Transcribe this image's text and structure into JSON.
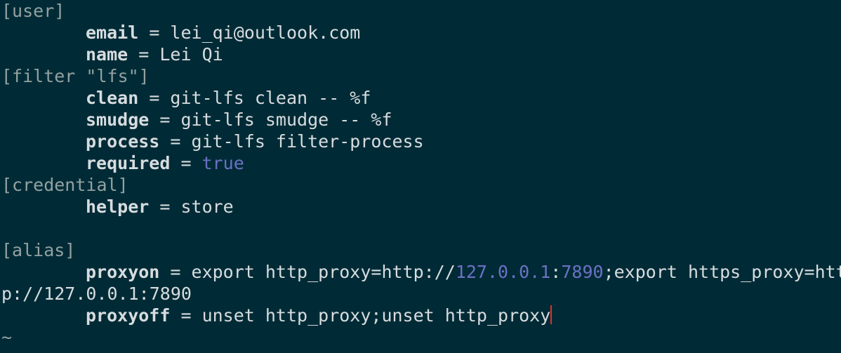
{
  "editor": {
    "lines": [
      {
        "type": "section",
        "text": "[user]"
      },
      {
        "type": "kv",
        "key": "email",
        "value": "lei_qi@outlook.com"
      },
      {
        "type": "kv",
        "key": "name",
        "value": "Lei Qi"
      },
      {
        "type": "section",
        "text": "[filter \"lfs\"]"
      },
      {
        "type": "kv",
        "key": "clean",
        "value": "git-lfs clean -- %f"
      },
      {
        "type": "kv",
        "key": "smudge",
        "value": "git-lfs smudge -- %f"
      },
      {
        "type": "kv",
        "key": "process",
        "value": "git-lfs filter-process"
      },
      {
        "type": "kv",
        "key": "required",
        "value": "true",
        "value_class": "boolean"
      },
      {
        "type": "section",
        "text": "[credential]"
      },
      {
        "type": "kv",
        "key": "helper",
        "value": "store"
      },
      {
        "type": "blank",
        "text": ""
      },
      {
        "type": "section",
        "text": "[alias]"
      },
      {
        "type": "kv_parts",
        "key": "proxyon",
        "parts": [
          {
            "text": "export http_proxy=http://",
            "class": "val"
          },
          {
            "text": "127.0.0.1",
            "class": "number"
          },
          {
            "text": ":",
            "class": "val"
          },
          {
            "text": "7890",
            "class": "number"
          },
          {
            "text": ";export https_proxy=htt",
            "class": "val"
          }
        ]
      },
      {
        "type": "wrap",
        "text": "p://127.0.0.1:7890"
      },
      {
        "type": "kv",
        "key": "proxyoff",
        "value": "unset http_proxy;unset http_proxy",
        "cursor": true
      },
      {
        "type": "tilde",
        "text": "~"
      }
    ]
  }
}
